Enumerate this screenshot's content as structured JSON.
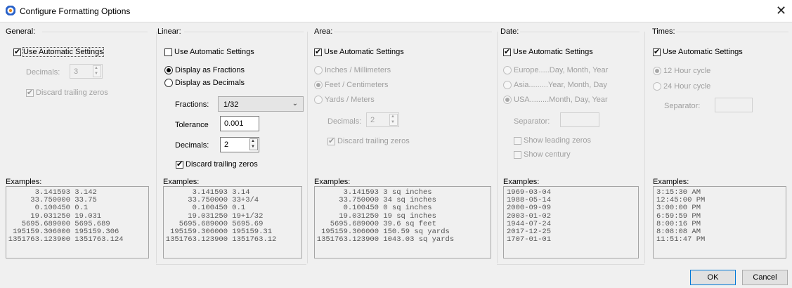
{
  "window": {
    "title": "Configure Formatting Options",
    "icon": "app-logo-icon",
    "close_glyph": "✕"
  },
  "general": {
    "title": "General:",
    "use_auto": {
      "label": "Use Automatic Settings",
      "checked": true
    },
    "decimals_label": "Decimals:",
    "decimals_value": "3",
    "discard_trailing": {
      "label": "Discard trailing zeros",
      "checked": true
    },
    "examples_label": "Examples:",
    "examples": [
      [
        "3.141593",
        "3.142"
      ],
      [
        "33.750000",
        "33.75"
      ],
      [
        "0.100450",
        "0.1"
      ],
      [
        "19.031250",
        "19.031"
      ],
      [
        "5695.689000",
        "5695.689"
      ],
      [
        "195159.306000",
        "195159.306"
      ],
      [
        "1351763.123900",
        "1351763.124"
      ]
    ]
  },
  "linear": {
    "title": "Linear:",
    "use_auto": {
      "label": "Use Automatic Settings",
      "checked": false
    },
    "display_fractions": {
      "label": "Display as Fractions",
      "checked": true
    },
    "display_decimals": {
      "label": "Display as Decimals",
      "checked": false
    },
    "fractions_label": "Fractions:",
    "fractions_value": "1/32",
    "tolerance_label": "Tolerance",
    "tolerance_value": "0.001",
    "decimals_label": "Decimals:",
    "decimals_value": "2",
    "discard_trailing": {
      "label": "Discard trailing zeros",
      "checked": true
    },
    "examples_label": "Examples:",
    "examples": [
      [
        "3.141593",
        "3.14"
      ],
      [
        "33.750000",
        "33+3/4"
      ],
      [
        "0.100450",
        "0.1"
      ],
      [
        "19.031250",
        "19+1/32"
      ],
      [
        "5695.689000",
        "5695.69"
      ],
      [
        "195159.306000",
        "195159.31"
      ],
      [
        "1351763.123900",
        "1351763.12"
      ]
    ]
  },
  "area": {
    "title": "Area:",
    "use_auto": {
      "label": "Use Automatic Settings",
      "checked": true
    },
    "units": [
      {
        "label": "Inches / Millimeters",
        "checked": false
      },
      {
        "label": "Feet / Centimeters",
        "checked": true
      },
      {
        "label": "Yards / Meters",
        "checked": false
      }
    ],
    "decimals_label": "Decimals:",
    "decimals_value": "2",
    "discard_trailing": {
      "label": "Discard trailing zeros",
      "checked": true
    },
    "examples_label": "Examples:",
    "examples": [
      [
        "3.141593",
        "3 sq inches"
      ],
      [
        "33.750000",
        "34 sq inches"
      ],
      [
        "0.100450",
        "0 sq inches"
      ],
      [
        "19.031250",
        "19 sq inches"
      ],
      [
        "5695.689000",
        "39.6 sq feet"
      ],
      [
        "195159.306000",
        "150.59 sq yards"
      ],
      [
        "1351763.123900",
        "1043.03 sq yards"
      ]
    ]
  },
  "date": {
    "title": "Date:",
    "use_auto": {
      "label": "Use Automatic Settings",
      "checked": true
    },
    "formats": [
      {
        "label": "Europe.....Day, Month, Year",
        "checked": false
      },
      {
        "label": "Asia.........Year, Month, Day",
        "checked": false
      },
      {
        "label": "USA.........Month, Day, Year",
        "checked": true
      }
    ],
    "separator_label": "Separator:",
    "separator_value": "",
    "show_leading_zeros": {
      "label": "Show leading zeros",
      "checked": false
    },
    "show_century": {
      "label": "Show century",
      "checked": false
    },
    "examples_label": "Examples:",
    "examples": [
      "1969-03-04",
      "1988-05-14",
      "2000-09-09",
      "2003-01-02",
      "1944-07-24",
      "2017-12-25",
      "1707-01-01"
    ]
  },
  "times": {
    "title": "Times:",
    "use_auto": {
      "label": "Use Automatic Settings",
      "checked": true
    },
    "cycles": [
      {
        "label": "12 Hour cycle",
        "checked": true
      },
      {
        "label": "24 Hour cycle",
        "checked": false
      }
    ],
    "separator_label": "Separator:",
    "separator_value": "",
    "examples_label": "Examples:",
    "examples": [
      "3:15:30 AM",
      "12:45:00 PM",
      "3:00:00 PM",
      "6:59:59 PM",
      "8:00:16 PM",
      "8:08:08 AM",
      "11:51:47 PM"
    ]
  },
  "buttons": {
    "ok": "OK",
    "cancel": "Cancel"
  },
  "colors": {
    "accent": "#0078d7",
    "disabled_text": "#a0a0a0",
    "background": "#f0f0f0"
  }
}
